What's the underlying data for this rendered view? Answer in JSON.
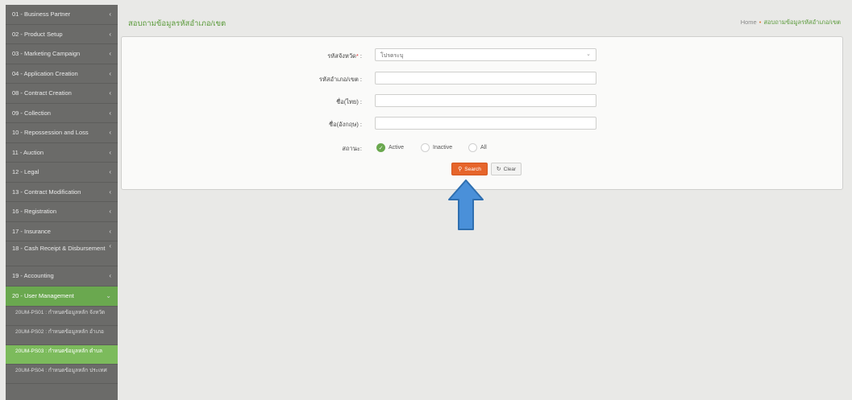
{
  "sidebar": {
    "items": [
      {
        "label": "01 - Business Partner"
      },
      {
        "label": "02 - Product Setup"
      },
      {
        "label": "03 - Marketing Campaign"
      },
      {
        "label": "04 - Application Creation"
      },
      {
        "label": "08 - Contract Creation"
      },
      {
        "label": "09 - Collection"
      },
      {
        "label": "10 - Repossession and Loss"
      },
      {
        "label": "11 - Auction"
      },
      {
        "label": "12 - Legal"
      },
      {
        "label": "13 - Contract Modification"
      },
      {
        "label": "16 - Registration"
      },
      {
        "label": "17 - Insurance"
      },
      {
        "label": "18 - Cash Receipt & Disbursement"
      },
      {
        "label": "19 - Accounting"
      },
      {
        "label": "20 - User Management"
      }
    ],
    "subitems": [
      {
        "label": "20UM-PS01 : กำหนดข้อมูลหลัก จังหวัด"
      },
      {
        "label": "20UM-PS02 : กำหนดข้อมูลหลัก อำเภอ"
      },
      {
        "label": "20UM-PS03 : กำหนดข้อมูลหลัก ตำบล"
      },
      {
        "label": "20UM-PS04 : กำหนดข้อมูลหลัก ประเทศ"
      }
    ],
    "chevron": "‹",
    "chevron_open": "⌄"
  },
  "header": {
    "title": "สอบถามข้อมูลรหัสอำเภอ/เขต",
    "breadcrumb_home": "Home",
    "breadcrumb_sep": "•",
    "breadcrumb_current": "สอบถามข้อมูลรหัสอำเภอ/เขต"
  },
  "form": {
    "province_label": "รหัสจังหวัด",
    "province_required": "*",
    "province_value": "โปรดระบุ",
    "district_code_label": "รหัสอำเภอ/เขต :",
    "name_th_label": "ชื่อ(ไทย) :",
    "name_en_label": "ชื่อ(อังกฤษ) :",
    "status_label": "สถานะ",
    "status_options": {
      "active": "Active",
      "inactive": "Inactive",
      "all": "All"
    },
    "search_label": "Search",
    "clear_label": "Clear"
  },
  "colors": {
    "accent_green": "#6aa84f",
    "search_orange": "#e6652b",
    "arrow_blue": "#4a90d9"
  }
}
